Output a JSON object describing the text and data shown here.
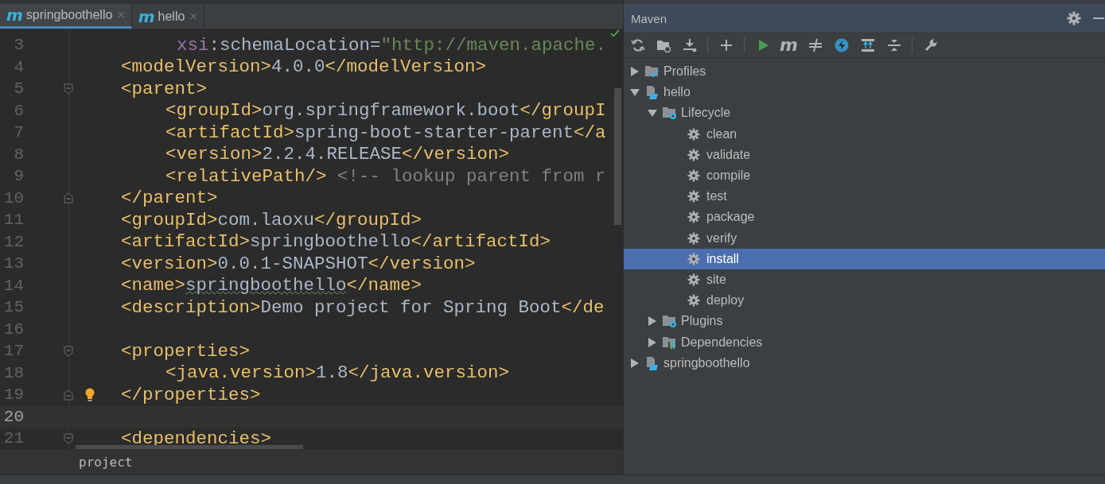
{
  "editor": {
    "tabs": [
      {
        "badge": "m",
        "label": "springboothello",
        "close": "×",
        "selected": true
      },
      {
        "badge": "m",
        "label": "hello",
        "close": "×",
        "selected": false
      }
    ],
    "lines": [
      {
        "number": "3",
        "current": false,
        "kind": "continuation",
        "tokens": [
          {
            "kind": "attr",
            "s": "xsi"
          },
          {
            "kind": "text",
            "s": ":schemaLocation="
          },
          {
            "kind": "string",
            "s": "\"http://maven.apache."
          }
        ]
      },
      {
        "number": "4",
        "current": false,
        "kind": "outer",
        "tokens": [
          {
            "kind": "tag",
            "s": "<modelVersion>"
          },
          {
            "kind": "text",
            "s": "4.0.0"
          },
          {
            "kind": "tag",
            "s": "</modelVersion>"
          }
        ]
      },
      {
        "number": "5",
        "current": false,
        "kind": "outer",
        "fold_start": true,
        "tokens": [
          {
            "kind": "tag",
            "s": "<parent>"
          }
        ]
      },
      {
        "number": "6",
        "current": false,
        "kind": "inner",
        "tokens": [
          {
            "kind": "tag",
            "s": "<groupId>"
          },
          {
            "kind": "text",
            "s": "org.springframework.boot"
          },
          {
            "kind": "tag",
            "s": "</groupI"
          }
        ]
      },
      {
        "number": "7",
        "current": false,
        "kind": "inner",
        "tokens": [
          {
            "kind": "tag",
            "s": "<artifactId>"
          },
          {
            "kind": "text",
            "s": "spring-boot-starter-parent"
          },
          {
            "kind": "tag",
            "s": "</a"
          }
        ]
      },
      {
        "number": "8",
        "current": false,
        "kind": "inner",
        "tokens": [
          {
            "kind": "tag",
            "s": "<version>"
          },
          {
            "kind": "text",
            "s": "2.2.4.RELEASE"
          },
          {
            "kind": "tag",
            "s": "</version>"
          }
        ]
      },
      {
        "number": "9",
        "current": false,
        "kind": "inner",
        "tokens": [
          {
            "kind": "tag",
            "s": "<relativePath/>"
          },
          {
            "kind": "comment",
            "s": "<!-- lookup parent from r"
          }
        ]
      },
      {
        "number": "10",
        "current": false,
        "kind": "outer",
        "fold_end": true,
        "tokens": [
          {
            "kind": "tag",
            "s": "</parent>"
          }
        ]
      },
      {
        "number": "11",
        "current": false,
        "kind": "outer",
        "tokens": [
          {
            "kind": "tag",
            "s": "<groupId>"
          },
          {
            "kind": "text",
            "s": "com.laoxu"
          },
          {
            "kind": "tag",
            "s": "</groupId>"
          }
        ]
      },
      {
        "number": "12",
        "current": false,
        "kind": "outer",
        "tokens": [
          {
            "kind": "tag",
            "s": "<artifactId>"
          },
          {
            "kind": "text",
            "s": "springboothello"
          },
          {
            "kind": "tag",
            "s": "</artifactId>"
          }
        ]
      },
      {
        "number": "13",
        "current": false,
        "kind": "outer",
        "tokens": [
          {
            "kind": "tag",
            "s": "<version>"
          },
          {
            "kind": "text",
            "s": "0.0.1-SNAPSHOT"
          },
          {
            "kind": "tag",
            "s": "</version>"
          }
        ]
      },
      {
        "number": "14",
        "current": false,
        "kind": "outer",
        "tokens": [
          {
            "kind": "tag",
            "s": "<name>"
          },
          {
            "kind": "typo",
            "s": "springboothello"
          },
          {
            "kind": "tag",
            "s": "</name>"
          }
        ]
      },
      {
        "number": "15",
        "current": false,
        "kind": "outer",
        "tokens": [
          {
            "kind": "tag",
            "s": "<description>"
          },
          {
            "kind": "text",
            "s": "Demo project for Spring Boot"
          },
          {
            "kind": "tag",
            "s": "</de"
          }
        ]
      },
      {
        "number": "16",
        "current": false
      },
      {
        "number": "17",
        "current": false,
        "kind": "outer",
        "fold_start": true,
        "tokens": [
          {
            "kind": "tag",
            "s": "<properties>"
          }
        ]
      },
      {
        "number": "18",
        "current": false,
        "kind": "inner",
        "tokens": [
          {
            "kind": "tag",
            "s": "<java.version>"
          },
          {
            "kind": "text",
            "s": "1.8"
          },
          {
            "kind": "tag",
            "s": "</java.version>"
          }
        ]
      },
      {
        "number": "19",
        "current": false,
        "kind": "outer",
        "fold_end": true,
        "bulb": true,
        "tokens": [
          {
            "kind": "tag",
            "s": "</properties>"
          }
        ]
      },
      {
        "number": "20",
        "current": true
      },
      {
        "number": "21",
        "current": false,
        "kind": "outer",
        "fold_start": true,
        "tokens": [
          {
            "kind": "tag",
            "s": "<dependencies>"
          }
        ]
      }
    ],
    "breadcrumb": "project"
  },
  "maven": {
    "title": "Maven",
    "toolbar": [
      {
        "kind": "reload"
      },
      {
        "kind": "folder"
      },
      {
        "kind": "download"
      },
      {
        "kind": "sep"
      },
      {
        "kind": "plus"
      },
      {
        "kind": "sep"
      },
      {
        "kind": "run"
      },
      {
        "kind": "m",
        "text": "m"
      },
      {
        "kind": "skip"
      },
      {
        "kind": "bolt"
      },
      {
        "kind": "deps"
      },
      {
        "kind": "collapse"
      },
      {
        "kind": "sep"
      },
      {
        "kind": "wrench"
      }
    ],
    "tree": [
      {
        "label": "Profiles",
        "kind": "profiles",
        "expanded": false,
        "selected": false
      },
      {
        "label": "hello",
        "kind": "module",
        "expanded": true,
        "selected": false,
        "children": [
          {
            "label": "Lifecycle",
            "kind": "lifecycle",
            "expanded": true,
            "selected": false,
            "children": [
              {
                "label": "clean",
                "kind": "goal",
                "selected": false
              },
              {
                "label": "validate",
                "kind": "goal",
                "selected": false
              },
              {
                "label": "compile",
                "kind": "goal",
                "selected": false
              },
              {
                "label": "test",
                "kind": "goal",
                "selected": false
              },
              {
                "label": "package",
                "kind": "goal",
                "selected": false
              },
              {
                "label": "verify",
                "kind": "goal",
                "selected": false
              },
              {
                "label": "install",
                "kind": "goal",
                "selected": true
              },
              {
                "label": "site",
                "kind": "goal",
                "selected": false
              },
              {
                "label": "deploy",
                "kind": "goal",
                "selected": false
              }
            ]
          },
          {
            "label": "Plugins",
            "kind": "plugins",
            "expanded": false,
            "selected": false
          },
          {
            "label": "Dependencies",
            "kind": "dependencies",
            "expanded": false,
            "selected": false
          }
        ]
      },
      {
        "label": "springboothello",
        "kind": "module",
        "expanded": false,
        "selected": false
      }
    ]
  }
}
